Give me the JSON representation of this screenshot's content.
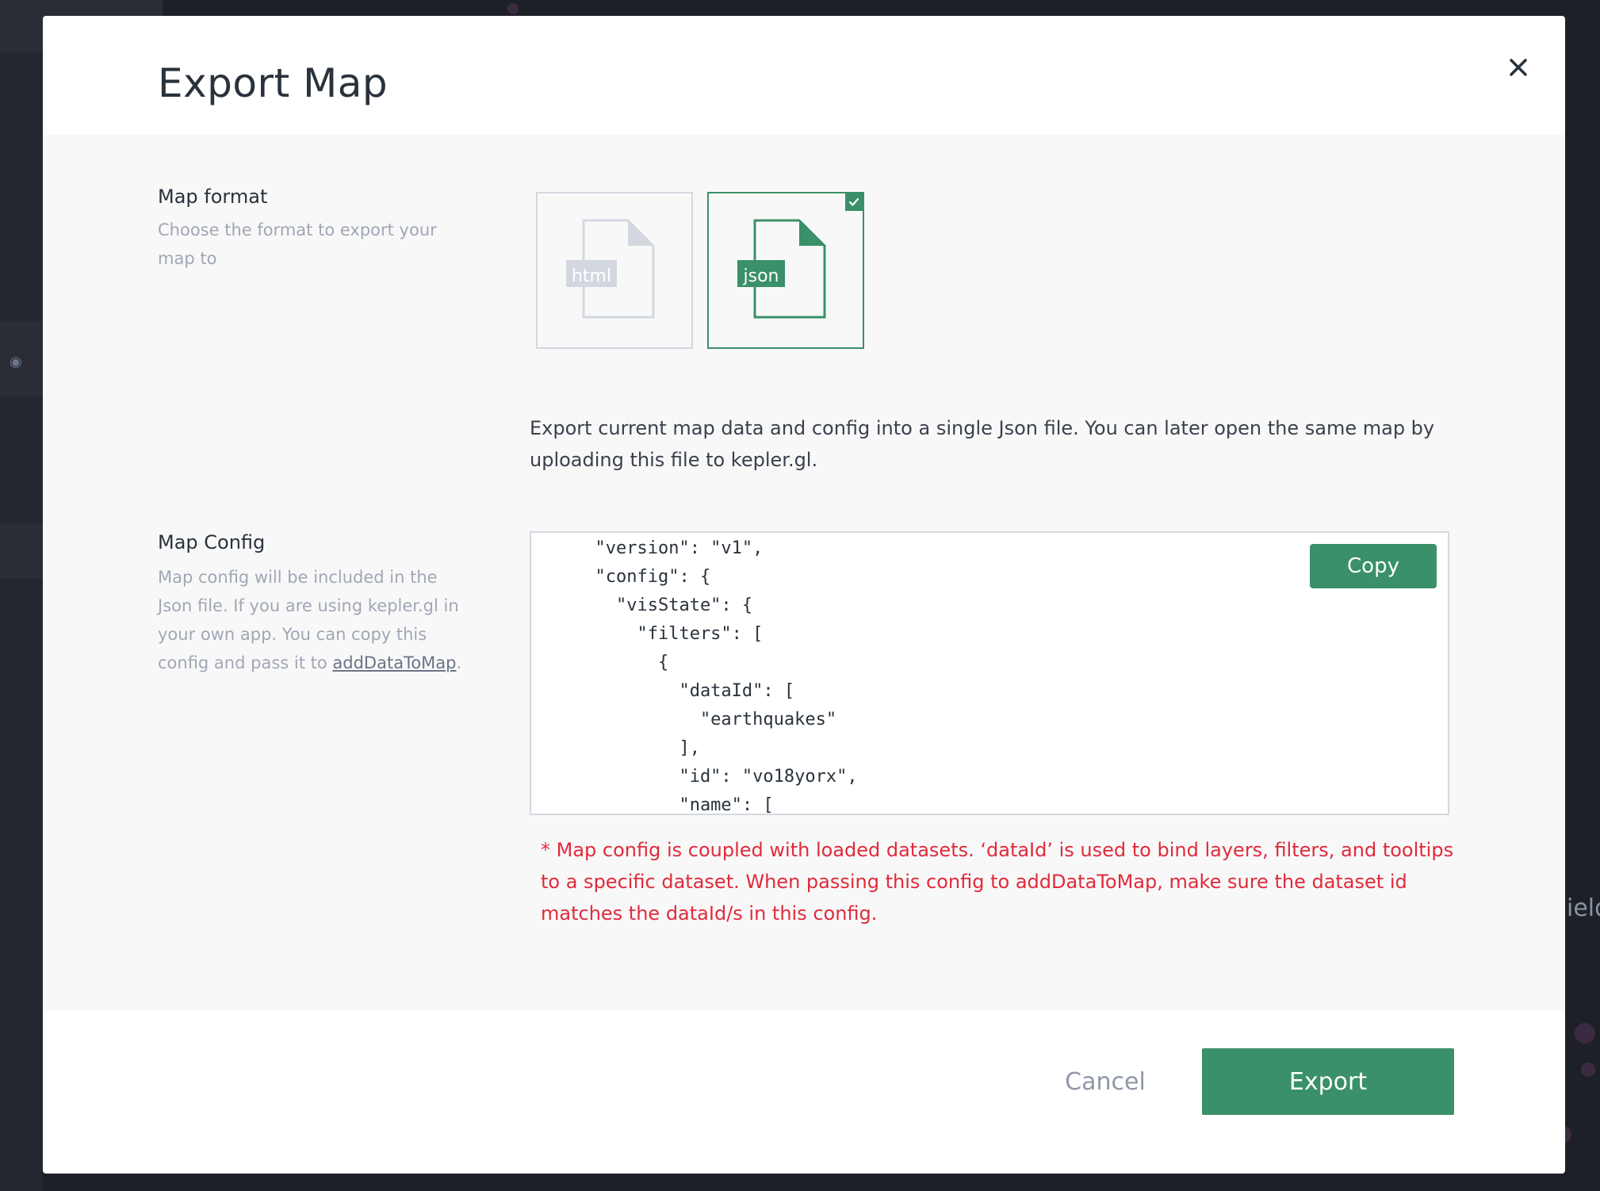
{
  "modal": {
    "title": "Export Map",
    "close_icon": "close-icon"
  },
  "map_format": {
    "title": "Map format",
    "description": "Choose the format to export your map to",
    "options": [
      {
        "label": "html",
        "selected": false
      },
      {
        "label": "json",
        "selected": true
      }
    ],
    "format_description": "Export current map data and config into a single Json file. You can later open the same map by uploading this file to kepler.gl."
  },
  "map_config": {
    "title": "Map Config",
    "description_before": "Map config will be included in the Json file. If you are using kepler.gl in your own app. You can copy this config and pass it to ",
    "description_link": "addDataToMap",
    "description_after": ".",
    "code": "  \"version\": \"v1\",\n  \"config\": {\n    \"visState\": {\n      \"filters\": [\n        {\n          \"dataId\": [\n            \"earthquakes\"\n          ],\n          \"id\": \"vo18yorx\",\n          \"name\": [",
    "copy_label": "Copy",
    "warning": "* Map config is coupled with loaded datasets. ‘dataId’ is used to bind layers, filters, and tooltips to a specific dataset. When passing this config to addDataToMap, make sure the dataset id matches the dataId/s in this config."
  },
  "footer": {
    "cancel_label": "Cancel",
    "export_label": "Export"
  },
  "background": {
    "right_text": "ield"
  },
  "colors": {
    "accent": "#3a9068",
    "warning": "#e02b3a",
    "title": "#29323c"
  }
}
